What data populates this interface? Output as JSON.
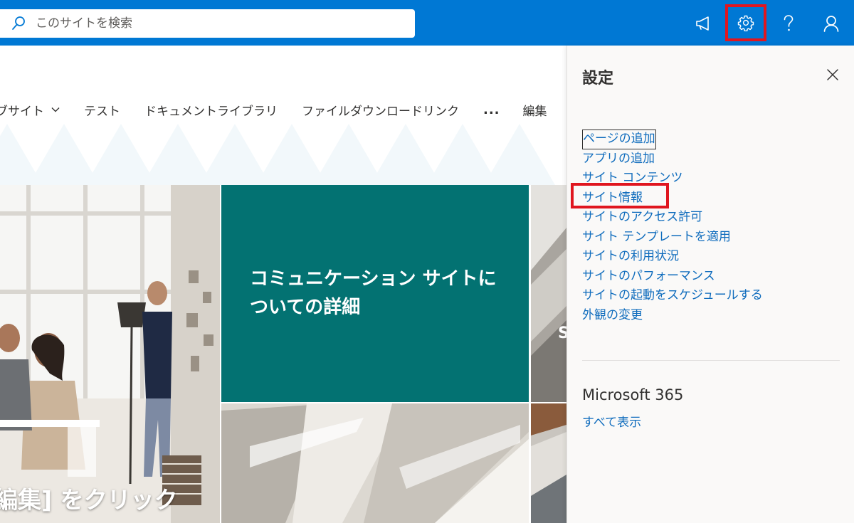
{
  "search": {
    "placeholder": "このサイトを検索"
  },
  "nav": {
    "items": [
      "ブサイト",
      "テスト",
      "ドキュメントライブラリ",
      "ファイルダウンロードリンク"
    ],
    "more": "...",
    "edit": "編集"
  },
  "hero": {
    "center_title_line1": "コミュニケーション サイトに",
    "center_title_line2": "ついての詳細",
    "left_caption": "編集] をクリック",
    "right_snippet": "S"
  },
  "settings": {
    "title": "設定",
    "links": [
      "ページの追加",
      "アプリの追加",
      "サイト コンテンツ",
      "サイト情報",
      "サイトのアクセス許可",
      "サイト テンプレートを適用",
      "サイトの利用状況",
      "サイトのパフォーマンス",
      "サイトの起動をスケジュールする",
      "外観の変更"
    ],
    "m365_title": "Microsoft 365",
    "m365_link": "すべて表示"
  },
  "colors": {
    "suite_bar": "#0078d4",
    "hero_teal": "#037272",
    "link": "#0f6cbd",
    "highlight": "#e0161f"
  },
  "icons": [
    "search-icon",
    "megaphone-icon",
    "gear-icon",
    "help-icon",
    "user-icon",
    "close-icon",
    "chevron-down-icon"
  ]
}
